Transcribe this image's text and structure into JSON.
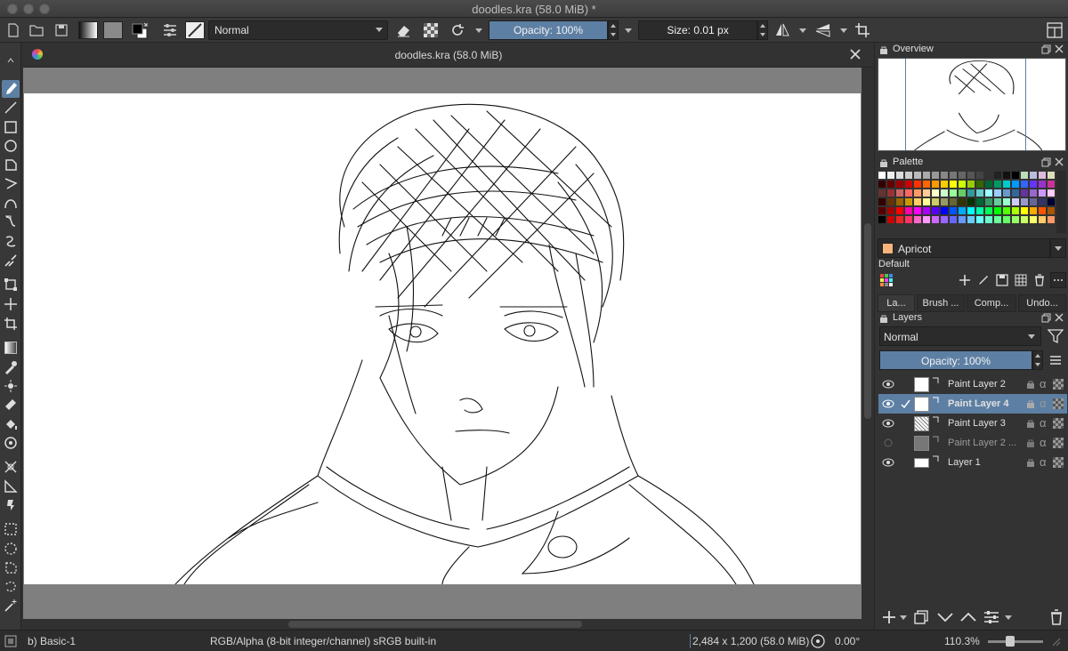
{
  "window": {
    "title": "doodles.kra (58.0 MiB) *"
  },
  "toolbar": {
    "blend_mode": "Normal",
    "opacity_label": "Opacity: 100%",
    "size_label": "Size: 0.01 px"
  },
  "document": {
    "tab_title": "doodles.kra (58.0 MiB)"
  },
  "dockers": {
    "overview_title": "Overview",
    "palette_title": "Palette",
    "palette": {
      "current_color": "Apricot",
      "current_color_hex": "#fbb57a",
      "set_name": "Default"
    },
    "tabs": [
      {
        "label": "La..."
      },
      {
        "label": "Brush ..."
      },
      {
        "label": "Comp..."
      },
      {
        "label": "Undo..."
      }
    ],
    "layers_title": "Layers",
    "layers": {
      "blend_mode": "Normal",
      "opacity_label": "Opacity:  100%",
      "items": [
        {
          "name": "Paint Layer 2",
          "visible": true,
          "selected": false
        },
        {
          "name": "Paint Layer 4",
          "visible": true,
          "selected": true
        },
        {
          "name": "Paint Layer 3",
          "visible": true,
          "selected": false
        },
        {
          "name": "Paint Layer 2 ...",
          "visible": false,
          "selected": false
        },
        {
          "name": "Layer 1",
          "visible": true,
          "selected": false
        }
      ]
    }
  },
  "statusbar": {
    "brush_preset": "b) Basic-1",
    "color_model": "RGB/Alpha (8-bit integer/channel)  sRGB built-in",
    "image_size": "2,484 x 1,200 (58.0 MiB)",
    "rotation": "0.00°",
    "zoom": "110.3%"
  },
  "colors": {
    "accent": "#5d7fa3",
    "panel": "#333333",
    "canvas_bg": "#7f7f7f"
  }
}
